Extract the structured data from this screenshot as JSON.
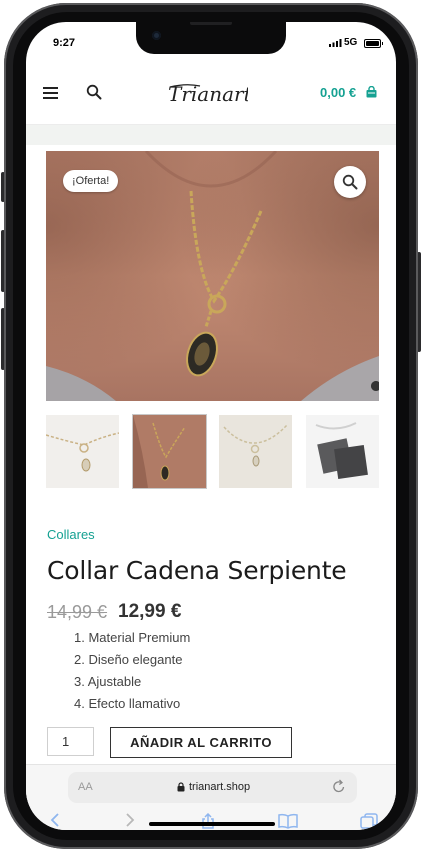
{
  "status_bar": {
    "time": "9:27",
    "network": "5G"
  },
  "header": {
    "logo_text": "Trianart",
    "cart_total": "0,00 €"
  },
  "product": {
    "sale_badge": "¡Oferta!",
    "category": "Collares",
    "title": "Collar Cadena Serpiente",
    "old_price": "14,99 €",
    "price": "12,99 €",
    "features": [
      "Material Premium",
      "Diseño elegante",
      "Ajustable",
      "Efecto llamativo"
    ],
    "quantity": "1",
    "add_to_cart": "AÑADIR AL CARRITO"
  },
  "browser": {
    "text_size_label": "AA",
    "url": "trianart.shop"
  },
  "colors": {
    "accent": "#15a192",
    "text": "#1b1b1b"
  },
  "icons": [
    "menu-icon",
    "search-icon",
    "cart-bag-icon",
    "zoom-icon",
    "lock-icon",
    "reload-icon",
    "back-icon",
    "forward-icon",
    "share-icon",
    "bookmarks-icon",
    "tabs-icon"
  ]
}
